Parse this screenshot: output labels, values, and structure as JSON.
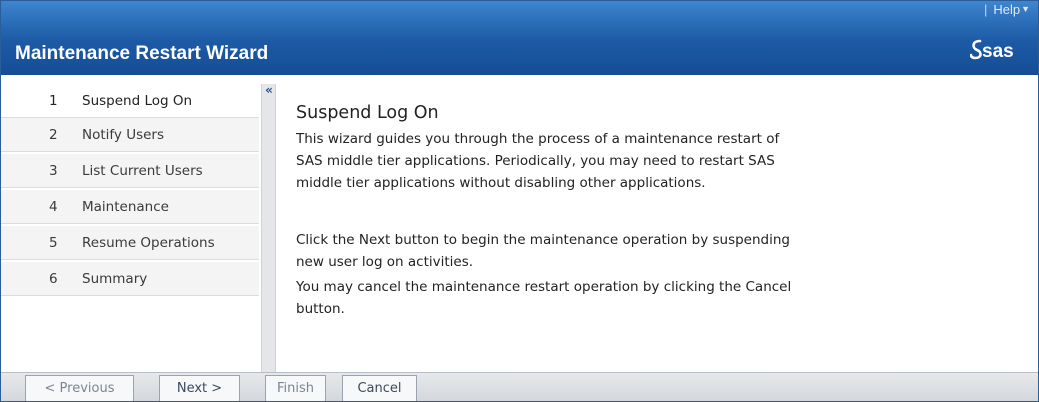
{
  "header": {
    "help_label": "Help",
    "title": "Maintenance Restart Wizard",
    "logo_text": "sas",
    "colors": {
      "header_top": "#3f86cf",
      "header_bottom": "#154d95"
    }
  },
  "nav": {
    "collapse_glyph": "«",
    "items": [
      {
        "number": "1",
        "label": "Suspend Log On"
      },
      {
        "number": "2",
        "label": "Notify Users"
      },
      {
        "number": "3",
        "label": "List Current Users"
      },
      {
        "number": "4",
        "label": "Maintenance"
      },
      {
        "number": "5",
        "label": "Resume Operations"
      },
      {
        "number": "6",
        "label": "Summary"
      }
    ]
  },
  "content": {
    "title": "Suspend Log On",
    "paragraphs": [
      "This wizard guides you through the process of a maintenance restart of SAS middle tier applications. Periodically, you may need to restart SAS middle tier applications without disabling other applications.",
      "Click the Next button to begin the maintenance operation by suspending new user log on activities.",
      "You may cancel the maintenance restart operation by clicking the Cancel button."
    ]
  },
  "footer": {
    "previous_label": "< Previous",
    "next_label": "Next >",
    "finish_label": "Finish",
    "cancel_label": "Cancel"
  }
}
